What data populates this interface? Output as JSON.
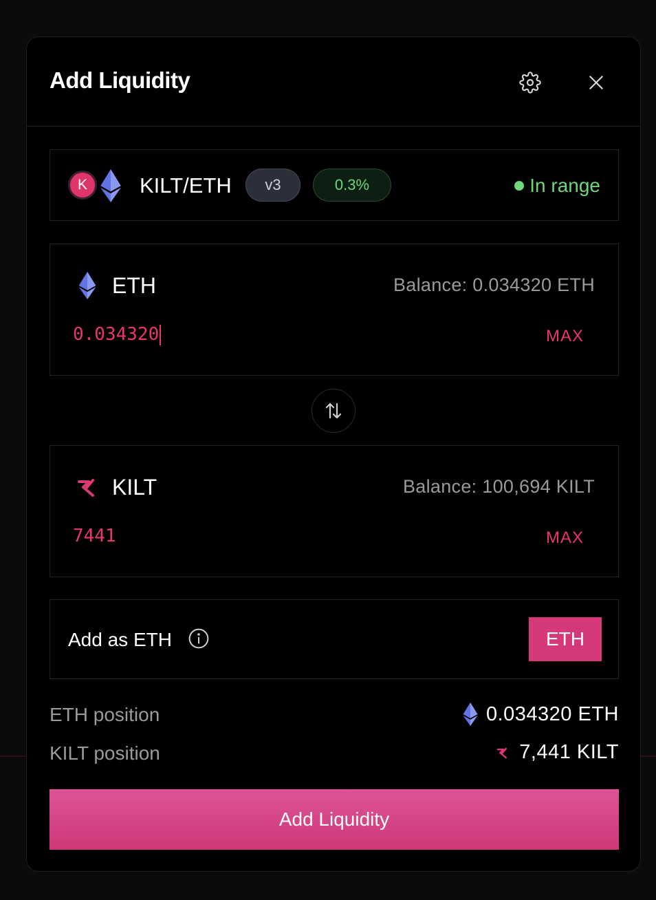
{
  "modal": {
    "title": "Add Liquidity",
    "settings_icon": "gear-icon",
    "close_icon": "close-icon"
  },
  "pool": {
    "pair": "KILT/ETH",
    "token0_letter": "K",
    "version": "v3",
    "fee": "0.3%",
    "status": "In range",
    "status_color": "#6fd67a"
  },
  "eth_input": {
    "token": "ETH",
    "balance": "Balance: 0.034320 ETH",
    "amount": "0.034320",
    "max_label": "MAX"
  },
  "kilt_input": {
    "token": "KILT",
    "balance": "Balance: 100,694 KILT",
    "amount": "7441",
    "max_label": "MAX"
  },
  "add_as": {
    "label": "Add as ETH",
    "toggle_label": "ETH"
  },
  "positions": {
    "eth_label": "ETH position",
    "eth_value": "0.034320 ETH",
    "kilt_label": "KILT position",
    "kilt_value": "7,441 KILT"
  },
  "submit_label": "Add Liquidity",
  "colors": {
    "accent": "#e8356b",
    "button": "#d6397a",
    "eth": "#6274e4"
  }
}
